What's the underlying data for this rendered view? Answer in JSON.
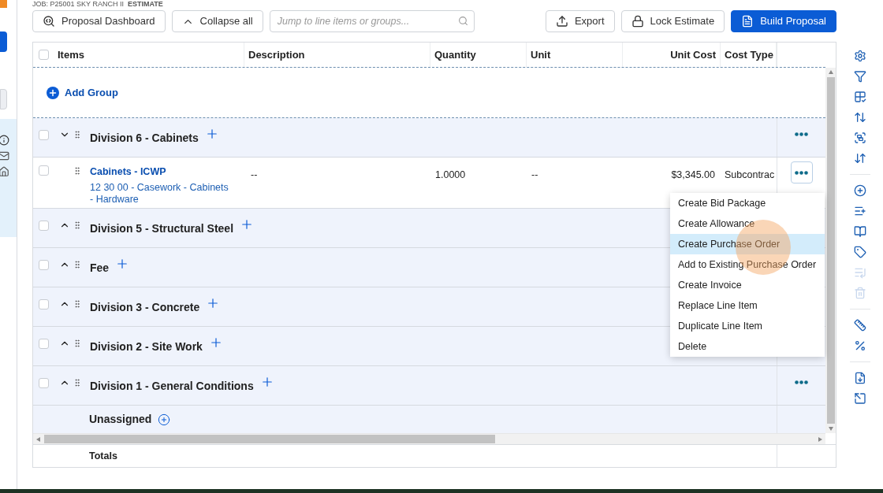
{
  "breadcrumb": {
    "job": "JOB: P25001 SKY RANCH II",
    "page": "ESTIMATE"
  },
  "toolbar": {
    "left_buttons": [
      "Proposal Dashboard",
      "Collapse all"
    ],
    "search": {
      "placeholder": "Jump to line items or groups..."
    },
    "right_buttons": [
      {
        "label": "Export",
        "kind": "plain"
      },
      {
        "label": "Lock Estimate",
        "kind": "plain"
      },
      {
        "label": "Build Proposal",
        "kind": "primary"
      }
    ]
  },
  "table": {
    "columns": [
      "Items",
      "Description",
      "Quantity",
      "Unit",
      "Unit Cost",
      "Cost Type"
    ],
    "header_checked": false,
    "add_group": "Add Group",
    "rows": [
      {
        "kind": "group",
        "title": "Division 6 - Cabinets",
        "expanded": true,
        "checked": false,
        "actions_shown": true
      },
      {
        "kind": "item",
        "title": "Cabinets - ICWP",
        "code": "12 30 00 - Casework - Cabinets - Hardware",
        "description": "--",
        "quantity": "1.0000",
        "unit": "--",
        "unit_cost": "$3,345.00",
        "cost_type": "Subcontrac",
        "checked": false,
        "actions_shown": true,
        "menu_open": true
      },
      {
        "kind": "group",
        "title": "Division 5 - Structural Steel",
        "expanded": false,
        "checked": false,
        "actions_shown": false
      },
      {
        "kind": "group",
        "title": "Fee",
        "expanded": false,
        "checked": false,
        "actions_shown": false
      },
      {
        "kind": "group",
        "title": "Division 3 - Concrete",
        "expanded": false,
        "checked": false,
        "actions_shown": false
      },
      {
        "kind": "group",
        "title": "Division 2 - Site Work",
        "expanded": false,
        "checked": false,
        "actions_shown": false
      },
      {
        "kind": "group",
        "title": "Division 1 - General Conditions",
        "expanded": false,
        "checked": false,
        "actions_shown": true
      },
      {
        "kind": "unassigned",
        "title": "Unassigned"
      }
    ],
    "totals": "Totals"
  },
  "menu": [
    {
      "label": "Create Bid Package",
      "selected": false
    },
    {
      "label": "Create Allowance",
      "selected": false
    },
    {
      "label": "Create Purchase Order",
      "selected": true
    },
    {
      "label": "Add to Existing Purchase Order",
      "selected": false
    },
    {
      "label": "Create Invoice",
      "selected": false
    },
    {
      "label": "Replace Line Item",
      "selected": false
    },
    {
      "label": "Duplicate Line Item",
      "selected": false
    },
    {
      "label": "Delete",
      "selected": false
    }
  ],
  "right_toolbar": [
    {
      "disabled": false
    },
    {
      "disabled": false
    },
    {
      "disabled": false
    },
    {
      "disabled": false
    },
    {
      "disabled": false
    },
    {
      "disabled": false
    },
    {
      "disabled": false
    },
    {
      "disabled": false
    },
    {
      "disabled": false
    },
    {
      "disabled": false
    },
    {
      "disabled": true
    },
    {
      "disabled": true
    },
    {
      "disabled": false
    },
    {
      "disabled": false
    },
    {
      "disabled": false
    },
    {
      "disabled": false
    }
  ]
}
